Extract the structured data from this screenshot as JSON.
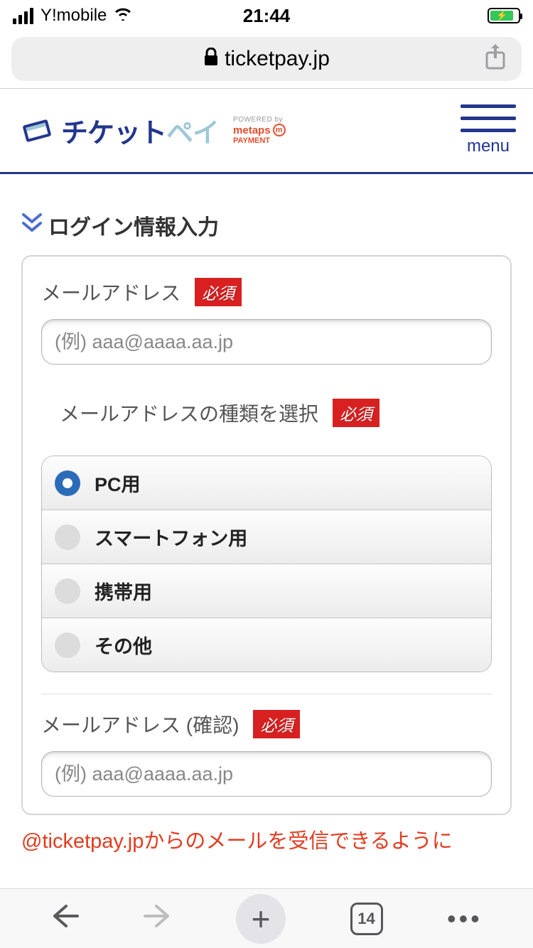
{
  "status_bar": {
    "carrier": "Y!mobile",
    "time": "21:44"
  },
  "url_bar": {
    "domain": "ticketpay.jp"
  },
  "header": {
    "logo_part1": "チケット",
    "logo_part2": "ペイ",
    "powered_label": "POWERED by",
    "powered_brand": "metaps",
    "powered_sub": "PAYMENT",
    "menu_label": "menu"
  },
  "section": {
    "title": "ログイン情報入力"
  },
  "form": {
    "email_label": "メールアドレス",
    "email_placeholder": "(例) aaa@aaaa.aa.jp",
    "email_type_label": "メールアドレスの種類を選択",
    "email_confirm_label": "メールアドレス (確認)",
    "email_confirm_placeholder": "(例) aaa@aaaa.aa.jp",
    "required_badge": "必須",
    "radio_options": {
      "0": "PC用",
      "1": "スマートフォン用",
      "2": "携帯用",
      "3": "その他"
    }
  },
  "notice": "@ticketpay.jpからのメールを受信できるように",
  "bottom_bar": {
    "tab_count": "14"
  }
}
